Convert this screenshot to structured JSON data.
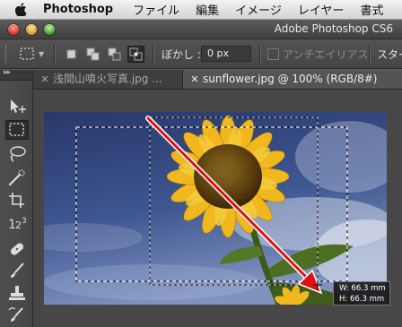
{
  "menubar": {
    "app_name": "Photoshop",
    "items": [
      "ファイル",
      "編集",
      "イメージ",
      "レイヤー",
      "書式"
    ]
  },
  "window": {
    "title": "Adobe Photoshop CS6"
  },
  "options_bar": {
    "feather_label": "ぼかし :",
    "feather_value": "0 px",
    "anti_alias_label": "アンチエイリアス",
    "anti_alias_checked": false,
    "style_label": "スタイル",
    "selection_modes": [
      "new-selection",
      "add-to-selection",
      "subtract-from-selection",
      "intersect-selection"
    ],
    "active_mode": "intersect-selection"
  },
  "tabs": [
    {
      "label": "浅間山噴火写真.jpg ...",
      "active": false
    },
    {
      "label": "sunflower.jpg @ 100% (RGB/8#)",
      "active": true
    }
  ],
  "toolbox": {
    "tools": [
      "move-tool",
      "marquee-tool",
      "lasso-tool",
      "quick-selection-tool",
      "crop-tool",
      "eyedropper-tool",
      "healing-brush-tool",
      "brush-tool",
      "clone-stamp-tool",
      "history-brush-tool"
    ],
    "selected": "marquee-tool"
  },
  "selection_readout": {
    "width": "W: 66.3 mm",
    "height": "H: 66.3 mm"
  },
  "colors": {
    "sky": "#3a4f84",
    "petal": "#f0b81e",
    "center": "#6b4a12",
    "arrow": "#e01010"
  }
}
